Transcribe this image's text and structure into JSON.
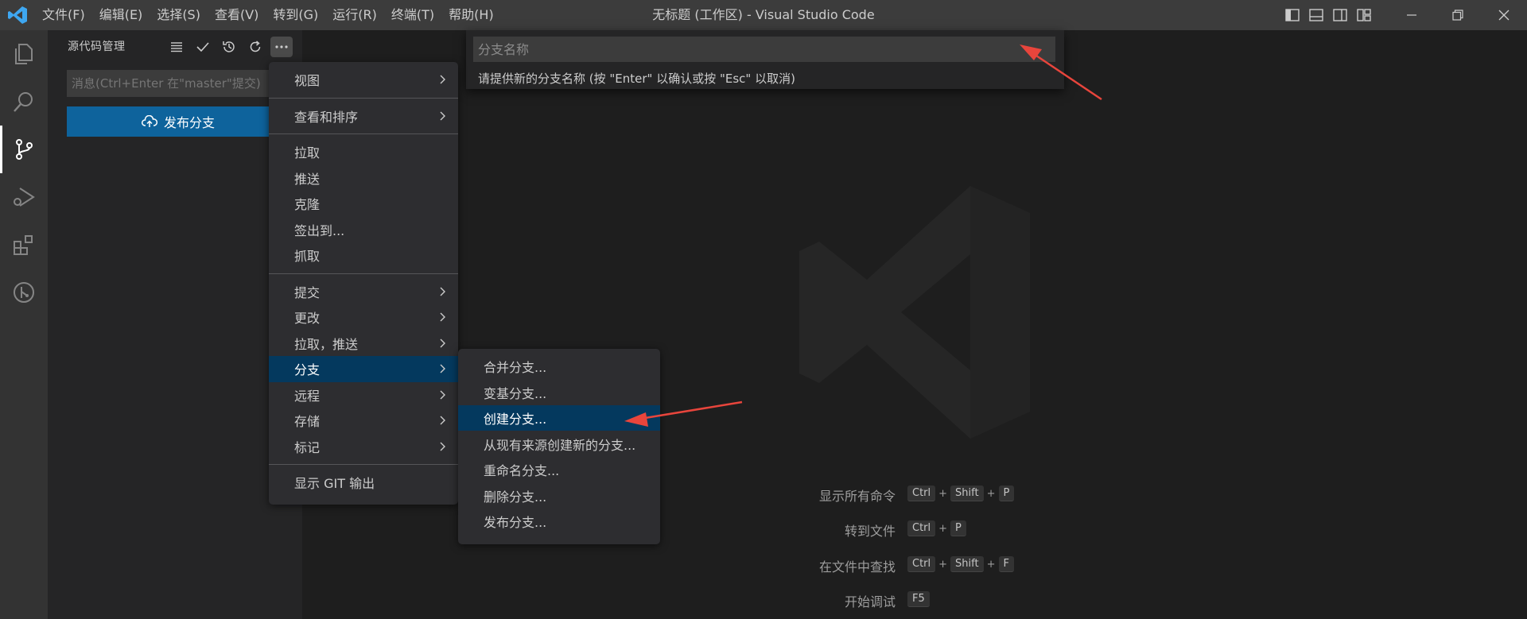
{
  "titlebar": {
    "menus": [
      "文件(F)",
      "编辑(E)",
      "选择(S)",
      "查看(V)",
      "转到(G)",
      "运行(R)",
      "终端(T)",
      "帮助(H)"
    ],
    "title": "无标题 (工作区) - Visual Studio Code"
  },
  "activitybar": {
    "items": [
      "files-icon",
      "search-icon",
      "source-control-icon",
      "run-debug-icon",
      "extensions-icon",
      "git-graph-icon"
    ],
    "active": "source-control-icon"
  },
  "sidebar": {
    "title": "源代码管理",
    "commit_placeholder": "消息(Ctrl+Enter 在\"master\"提交)",
    "publish_label": "发布分支"
  },
  "context_menu": {
    "groups": [
      [
        {
          "label": "视图",
          "submenu": true
        }
      ],
      [
        {
          "label": "查看和排序",
          "submenu": true
        }
      ],
      [
        {
          "label": "拉取",
          "submenu": false
        },
        {
          "label": "推送",
          "submenu": false
        },
        {
          "label": "克隆",
          "submenu": false
        },
        {
          "label": "签出到...",
          "submenu": false
        },
        {
          "label": "抓取",
          "submenu": false
        }
      ],
      [
        {
          "label": "提交",
          "submenu": true
        },
        {
          "label": "更改",
          "submenu": true
        },
        {
          "label": "拉取，推送",
          "submenu": true
        },
        {
          "label": "分支",
          "submenu": true
        },
        {
          "label": "远程",
          "submenu": true
        },
        {
          "label": "存储",
          "submenu": true
        },
        {
          "label": "标记",
          "submenu": true
        }
      ],
      [
        {
          "label": "显示 GIT 输出",
          "submenu": false
        }
      ]
    ],
    "highlighted": "分支"
  },
  "branch_submenu": {
    "items": [
      "合并分支...",
      "变基分支...",
      "创建分支...",
      "从现有来源创建新的分支...",
      "重命名分支...",
      "删除分支...",
      "发布分支..."
    ],
    "highlighted": "创建分支..."
  },
  "quick_input": {
    "placeholder": "分支名称",
    "message": "请提供新的分支名称 (按 \"Enter\" 以确认或按 \"Esc\" 以取消)"
  },
  "shortcuts": [
    {
      "label": "显示所有命令",
      "keys": [
        "Ctrl",
        "Shift",
        "P"
      ]
    },
    {
      "label": "转到文件",
      "keys": [
        "Ctrl",
        "P"
      ]
    },
    {
      "label": "在文件中查找",
      "keys": [
        "Ctrl",
        "Shift",
        "F"
      ]
    },
    {
      "label": "开始调试",
      "keys": [
        "F5"
      ]
    }
  ],
  "colors": {
    "accent": "#0e639c",
    "highlight": "#04395e",
    "annotation_arrow": "#e8453c"
  }
}
